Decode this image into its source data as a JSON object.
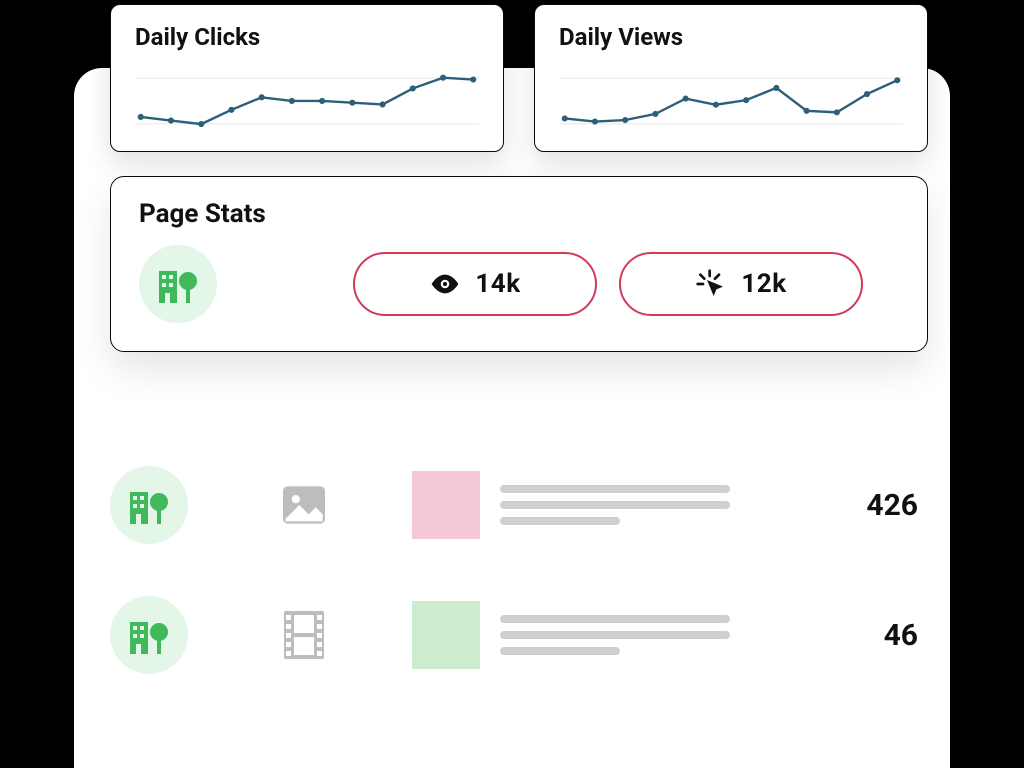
{
  "colors": {
    "chart_line": "#2d5f7a",
    "pill_border": "#d13a5b",
    "avatar_bg": "#e4f6e8",
    "icon_green": "#3fb95a",
    "swatch_pink": "#f4c9d5",
    "swatch_green": "#cbeccf",
    "placeholder_gray": "#cfcfcf"
  },
  "chart_data": [
    {
      "type": "line",
      "title": "Daily Clicks",
      "x": [
        1,
        2,
        3,
        4,
        5,
        6,
        7,
        8,
        9,
        10,
        11,
        12
      ],
      "values": [
        46,
        44,
        42,
        50,
        57,
        55,
        55,
        54,
        53,
        62,
        68,
        67
      ],
      "ylim": [
        40,
        70
      ],
      "xlabel": "",
      "ylabel": ""
    },
    {
      "type": "line",
      "title": "Daily Views",
      "x": [
        1,
        2,
        3,
        4,
        5,
        6,
        7,
        8,
        9,
        10,
        11,
        12
      ],
      "values": [
        46,
        44,
        45,
        49,
        59,
        55,
        58,
        66,
        51,
        50,
        62,
        71
      ],
      "ylim": [
        40,
        75
      ],
      "xlabel": "",
      "ylabel": ""
    }
  ],
  "page_stats": {
    "title": "Page Stats",
    "views": "14k",
    "clicks": "12k"
  },
  "list": [
    {
      "media_type": "image",
      "swatch": "pink",
      "count": "426"
    },
    {
      "media_type": "video",
      "swatch": "green",
      "count": "46"
    }
  ]
}
